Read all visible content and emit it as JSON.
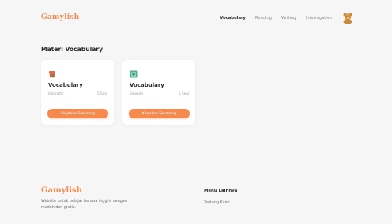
{
  "brand": {
    "name": "Gamylish",
    "accent_color": "#f08a52"
  },
  "nav": {
    "items": [
      {
        "label": "Vocabulary",
        "active": true
      },
      {
        "label": "Reading",
        "active": false
      },
      {
        "label": "Writing",
        "active": false
      },
      {
        "label": "Interrogative",
        "active": false
      }
    ],
    "avatar_icon": "bear-avatar-icon"
  },
  "section": {
    "title": "Materi Vocabulary"
  },
  "cards": [
    {
      "icon": "basket-icon",
      "title": "Vocabulary",
      "subtitle": "Idiomatic",
      "count": "5 Soal",
      "button": "Kerjakan Sekarang"
    },
    {
      "icon": "green-square-icon",
      "title": "Vocabulary",
      "subtitle": "Sinonim",
      "count": "5 Soal",
      "button": "Kerjakan Sekarang"
    }
  ],
  "footer": {
    "brand": "Gamylish",
    "description": "Website untuk belajar bahasa inggris dengan mudah dan gratis.",
    "menu_title": "Menu Lainnya",
    "links": [
      "Tentang Kami"
    ]
  },
  "colors": {
    "button": "#f58a4e",
    "background": "#f6f6f7",
    "card": "#ffffff"
  }
}
